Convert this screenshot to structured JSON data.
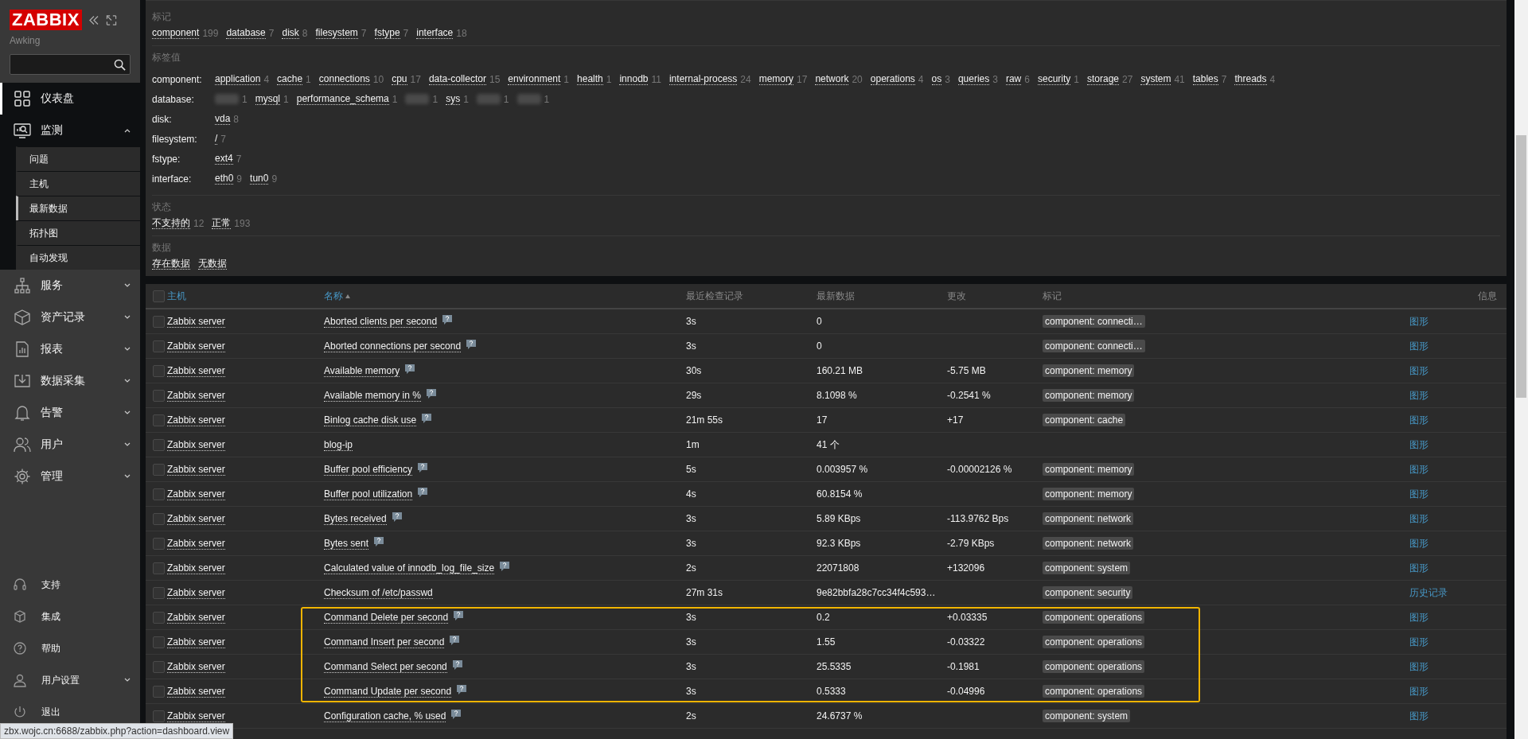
{
  "sidebar": {
    "logo": "ZABBIX",
    "server_name": "Awking",
    "nav": [
      {
        "label": "仪表盘",
        "selected": true,
        "expandable": false,
        "expanded": false
      },
      {
        "label": "监测",
        "selected": false,
        "expandable": true,
        "expanded": true,
        "children": [
          {
            "label": "问题",
            "selected": false
          },
          {
            "label": "主机",
            "selected": false
          },
          {
            "label": "最新数据",
            "selected": true
          },
          {
            "label": "拓扑图",
            "selected": false
          },
          {
            "label": "自动发现",
            "selected": false
          }
        ]
      },
      {
        "label": "服务",
        "selected": false,
        "expandable": true,
        "expanded": false
      },
      {
        "label": "资产记录",
        "selected": false,
        "expandable": true,
        "expanded": false
      },
      {
        "label": "报表",
        "selected": false,
        "expandable": true,
        "expanded": false
      },
      {
        "label": "数据采集",
        "selected": false,
        "expandable": true,
        "expanded": false
      },
      {
        "label": "告警",
        "selected": false,
        "expandable": true,
        "expanded": false
      },
      {
        "label": "用户",
        "selected": false,
        "expandable": true,
        "expanded": false
      },
      {
        "label": "管理",
        "selected": false,
        "expandable": true,
        "expanded": false
      }
    ],
    "bottom_nav": [
      {
        "label": "支持",
        "expandable": false
      },
      {
        "label": "集成",
        "expandable": false
      },
      {
        "label": "帮助",
        "expandable": false
      },
      {
        "label": "用户设置",
        "expandable": true
      },
      {
        "label": "退出",
        "expandable": false
      }
    ]
  },
  "filter": {
    "tags": {
      "title": "标记",
      "items": [
        {
          "label": "component",
          "count": "199"
        },
        {
          "label": "database",
          "count": "7"
        },
        {
          "label": "disk",
          "count": "8"
        },
        {
          "label": "filesystem",
          "count": "7"
        },
        {
          "label": "fstype",
          "count": "7"
        },
        {
          "label": "interface",
          "count": "18"
        }
      ]
    },
    "tag_values": {
      "title": "标签值",
      "rows": [
        {
          "name": "component:",
          "values": [
            {
              "label": "application",
              "count": "4"
            },
            {
              "label": "cache",
              "count": "1"
            },
            {
              "label": "connections",
              "count": "10"
            },
            {
              "label": "cpu",
              "count": "17"
            },
            {
              "label": "data-collector",
              "count": "15"
            },
            {
              "label": "environment",
              "count": "1"
            },
            {
              "label": "health",
              "count": "1"
            },
            {
              "label": "innodb",
              "count": "11"
            },
            {
              "label": "internal-process",
              "count": "24"
            },
            {
              "label": "memory",
              "count": "17"
            },
            {
              "label": "network",
              "count": "20"
            },
            {
              "label": "operations",
              "count": "4"
            },
            {
              "label": "os",
              "count": "3"
            },
            {
              "label": "queries",
              "count": "3"
            },
            {
              "label": "raw",
              "count": "6"
            },
            {
              "label": "security",
              "count": "1"
            },
            {
              "label": "storage",
              "count": "27"
            },
            {
              "label": "system",
              "count": "41"
            },
            {
              "label": "tables",
              "count": "7"
            },
            {
              "label": "threads",
              "count": "4"
            }
          ]
        },
        {
          "name": "database:",
          "values": [
            {
              "redacted": true,
              "count": "1"
            },
            {
              "label": "mysql",
              "count": "1"
            },
            {
              "label": "performance_schema",
              "count": "1"
            },
            {
              "redacted": true,
              "count": "1"
            },
            {
              "label": "sys",
              "count": "1"
            },
            {
              "redacted": true,
              "count": "1"
            },
            {
              "redacted": true,
              "count": "1"
            }
          ]
        },
        {
          "name": "disk:",
          "values": [
            {
              "label": "vda",
              "count": "8"
            }
          ]
        },
        {
          "name": "filesystem:",
          "values": [
            {
              "label": "/",
              "count": "7"
            }
          ]
        },
        {
          "name": "fstype:",
          "values": [
            {
              "label": "ext4",
              "count": "7"
            }
          ]
        },
        {
          "name": "interface:",
          "values": [
            {
              "label": "eth0",
              "count": "9"
            },
            {
              "label": "tun0",
              "count": "9"
            }
          ]
        }
      ]
    },
    "status": {
      "title": "状态",
      "items": [
        {
          "label": "不支持的",
          "count": "12"
        },
        {
          "label": "正常",
          "count": "193"
        }
      ]
    },
    "data": {
      "title": "数据",
      "items": [
        {
          "label": "存在数据"
        },
        {
          "label": "无数据"
        }
      ]
    }
  },
  "table": {
    "select_all": {
      "checked": false
    },
    "columns": [
      {
        "label": "主机",
        "kind": "link"
      },
      {
        "label": "名称",
        "kind": "link",
        "sorted": true
      },
      {
        "label": "最近检查记录",
        "kind": "plain"
      },
      {
        "label": "最新数据",
        "kind": "plain"
      },
      {
        "label": "更改",
        "kind": "plain"
      },
      {
        "label": "标记",
        "kind": "plain"
      },
      {
        "label": "信息",
        "kind": "plain"
      }
    ],
    "rows": [
      {
        "checked": false,
        "host": "Zabbix server",
        "name": "Aborted clients per second",
        "help": true,
        "last_check": "3s",
        "last_value": "0",
        "tag": "component: connecti…",
        "info": "图形",
        "highlighted": false
      },
      {
        "checked": false,
        "host": "Zabbix server",
        "name": "Aborted connections per second",
        "help": true,
        "last_check": "3s",
        "last_value": "0",
        "tag": "component: connecti…",
        "info": "图形",
        "highlighted": false
      },
      {
        "checked": false,
        "host": "Zabbix server",
        "name": "Available memory",
        "help": true,
        "last_check": "30s",
        "last_value": "160.21 MB",
        "change": "-5.75 MB",
        "tag": "component: memory",
        "info": "图形",
        "highlighted": false
      },
      {
        "checked": false,
        "host": "Zabbix server",
        "name": "Available memory in %",
        "help": true,
        "last_check": "29s",
        "last_value": "8.1098 %",
        "change": "-0.2541 %",
        "tag": "component: memory",
        "info": "图形",
        "highlighted": false
      },
      {
        "checked": false,
        "host": "Zabbix server",
        "name": "Binlog cache disk use",
        "help": true,
        "last_check": "21m 55s",
        "last_value": "17",
        "change": "+17",
        "tag": "component: cache",
        "info": "图形",
        "highlighted": false
      },
      {
        "checked": false,
        "host": "Zabbix server",
        "name": "blog-ip",
        "help": false,
        "last_check": "1m",
        "last_value": "41 个",
        "info": "图形",
        "highlighted": false
      },
      {
        "checked": false,
        "host": "Zabbix server",
        "name": "Buffer pool efficiency",
        "help": true,
        "last_check": "5s",
        "last_value": "0.003957 %",
        "change": "-0.00002126 %",
        "tag": "component: memory",
        "info": "图形",
        "highlighted": false
      },
      {
        "checked": false,
        "host": "Zabbix server",
        "name": "Buffer pool utilization",
        "help": true,
        "last_check": "4s",
        "last_value": "60.8154 %",
        "tag": "component: memory",
        "info": "图形",
        "highlighted": false
      },
      {
        "checked": false,
        "host": "Zabbix server",
        "name": "Bytes received",
        "help": true,
        "last_check": "3s",
        "last_value": "5.89 KBps",
        "change": "-113.9762 Bps",
        "tag": "component: network",
        "info": "图形",
        "highlighted": false
      },
      {
        "checked": false,
        "host": "Zabbix server",
        "name": "Bytes sent",
        "help": true,
        "last_check": "3s",
        "last_value": "92.3 KBps",
        "change": "-2.79 KBps",
        "tag": "component: network",
        "info": "图形",
        "highlighted": false
      },
      {
        "checked": false,
        "host": "Zabbix server",
        "name": "Calculated value of innodb_log_file_size",
        "help": true,
        "last_check": "2s",
        "last_value": "22071808",
        "change": "+132096",
        "tag": "component: system",
        "info": "图形",
        "highlighted": false
      },
      {
        "checked": false,
        "host": "Zabbix server",
        "name": "Checksum of /etc/passwd",
        "help": false,
        "last_check": "27m 31s",
        "last_value": "9e82bbfa28c7cc34f4c593…",
        "tag": "component: security",
        "info": "历史记录",
        "highlighted": false
      },
      {
        "checked": false,
        "host": "Zabbix server",
        "name": "Command Delete per second",
        "help": true,
        "last_check": "3s",
        "last_value": "0.2",
        "change": "+0.03335",
        "tag": "component: operations",
        "info": "图形",
        "highlighted": true
      },
      {
        "checked": false,
        "host": "Zabbix server",
        "name": "Command Insert per second",
        "help": true,
        "last_check": "3s",
        "last_value": "1.55",
        "change": "-0.03322",
        "tag": "component: operations",
        "info": "图形",
        "highlighted": true
      },
      {
        "checked": false,
        "host": "Zabbix server",
        "name": "Command Select per second",
        "help": true,
        "last_check": "3s",
        "last_value": "25.5335",
        "change": "-0.1981",
        "tag": "component: operations",
        "info": "图形",
        "highlighted": true
      },
      {
        "checked": false,
        "host": "Zabbix server",
        "name": "Command Update per second",
        "help": true,
        "last_check": "3s",
        "last_value": "0.5333",
        "change": "-0.04996",
        "tag": "component: operations",
        "info": "图形",
        "highlighted": true
      },
      {
        "checked": false,
        "host": "Zabbix server",
        "name": "Configuration cache, % used",
        "help": true,
        "last_check": "2s",
        "last_value": "24.6737 %",
        "tag": "component: system",
        "info": "图形",
        "highlighted": false
      }
    ]
  },
  "status_url": "zbx.wojc.cn:6688/zabbix.php?action=dashboard.view"
}
